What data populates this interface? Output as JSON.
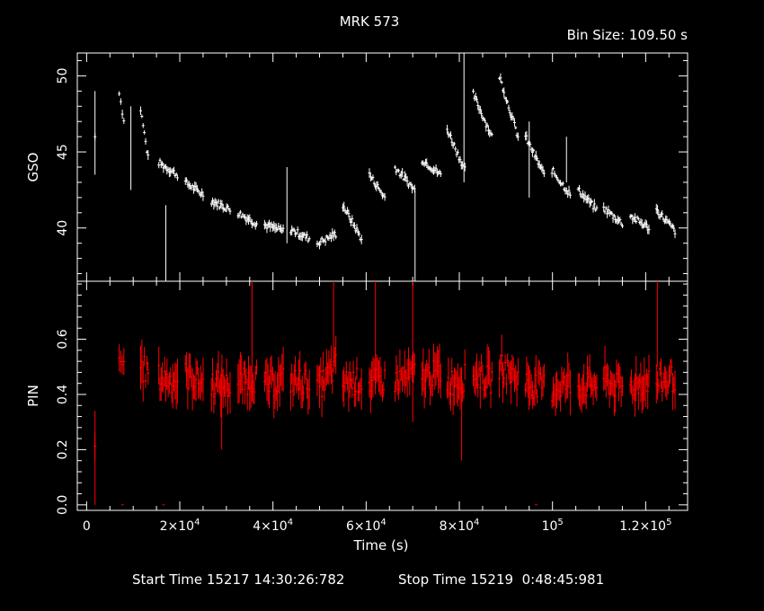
{
  "title": "MRK 573",
  "bin_size_label": "Bin Size: 109.50 s",
  "footer": {
    "start_label": "Start Time 15217 14:30:26:782",
    "stop_label": "Stop Time 15219  0:48:45:981"
  },
  "colors": {
    "background": "#000000",
    "gso": "#ffffff",
    "pin": "#ff0000",
    "axes": "#ffffff"
  },
  "chart_data": {
    "type": "scatter",
    "title": "MRK 573",
    "xlabel": "Time (s)",
    "xlim": [
      -2000,
      129000
    ],
    "x_ticks": [
      {
        "value": 0,
        "base": "0",
        "exp": ""
      },
      {
        "value": 20000,
        "base": "2×10",
        "exp": "4"
      },
      {
        "value": 40000,
        "base": "4×10",
        "exp": "4"
      },
      {
        "value": 60000,
        "base": "6×10",
        "exp": "4"
      },
      {
        "value": 80000,
        "base": "8×10",
        "exp": "4"
      },
      {
        "value": 100000,
        "base": "10",
        "exp": "5"
      },
      {
        "value": 120000,
        "base": "1.2×10",
        "exp": "5"
      }
    ],
    "panels": [
      {
        "name": "GSO",
        "ylabel": "GSO",
        "ylim": [
          36.5,
          51.5
        ],
        "y_ticks": [
          40,
          45,
          50
        ],
        "color": "#ffffff",
        "segments": [
          {
            "t0": 1800,
            "t1": 1800,
            "v0": 46,
            "v1": 46
          },
          {
            "t0": 7000,
            "t1": 8000,
            "v0": 49,
            "v1": 47
          },
          {
            "t0": 11600,
            "t1": 13200,
            "v0": 47.8,
            "v1": 44.6
          },
          {
            "t0": 15500,
            "t1": 19500,
            "v0": 44.3,
            "v1": 43.5
          },
          {
            "t0": 21200,
            "t1": 25000,
            "v0": 43,
            "v1": 42.2
          },
          {
            "t0": 26800,
            "t1": 30800,
            "v0": 41.8,
            "v1": 41.2
          },
          {
            "t0": 32500,
            "t1": 36500,
            "v0": 41,
            "v1": 40.3
          },
          {
            "t0": 38200,
            "t1": 42200,
            "v0": 40.2,
            "v1": 39.8
          },
          {
            "t0": 43800,
            "t1": 47800,
            "v0": 39.9,
            "v1": 39.3
          },
          {
            "t0": 49500,
            "t1": 53500,
            "v0": 39,
            "v1": 39.6
          },
          {
            "t0": 55000,
            "t1": 59000,
            "v0": 41.5,
            "v1": 39.3
          },
          {
            "t0": 60700,
            "t1": 64000,
            "v0": 43.5,
            "v1": 42
          },
          {
            "t0": 66200,
            "t1": 70400,
            "v0": 44,
            "v1": 42.5
          },
          {
            "t0": 72000,
            "t1": 76000,
            "v0": 44.5,
            "v1": 43.5
          },
          {
            "t0": 77400,
            "t1": 81200,
            "v0": 46.5,
            "v1": 43.8
          },
          {
            "t0": 83000,
            "t1": 87000,
            "v0": 48.8,
            "v1": 46
          },
          {
            "t0": 88600,
            "t1": 92600,
            "v0": 50,
            "v1": 46
          },
          {
            "t0": 94200,
            "t1": 98200,
            "v0": 46,
            "v1": 43.5
          },
          {
            "t0": 99900,
            "t1": 103800,
            "v0": 43.8,
            "v1": 42.2
          },
          {
            "t0": 105500,
            "t1": 109500,
            "v0": 42.5,
            "v1": 41.2
          },
          {
            "t0": 111000,
            "t1": 115000,
            "v0": 41.3,
            "v1": 40.3
          },
          {
            "t0": 116700,
            "t1": 120700,
            "v0": 40.8,
            "v1": 40
          },
          {
            "t0": 122300,
            "t1": 126300,
            "v0": 41.2,
            "v1": 39.8
          }
        ],
        "spikes": [
          {
            "t": 1800,
            "lo": 43.5,
            "hi": 49
          },
          {
            "t": 9500,
            "lo": 42.5,
            "hi": 48
          },
          {
            "t": 17000,
            "lo": 36.5,
            "hi": 41.5
          },
          {
            "t": 43000,
            "lo": 39,
            "hi": 44
          },
          {
            "t": 70500,
            "lo": 36.5,
            "hi": 42.5
          },
          {
            "t": 81000,
            "lo": 43,
            "hi": 51.5
          },
          {
            "t": 95000,
            "lo": 42,
            "hi": 47
          },
          {
            "t": 103000,
            "lo": 43,
            "hi": 46
          }
        ]
      },
      {
        "name": "PIN",
        "ylabel": "PIN",
        "ylim": [
          -0.02,
          0.81
        ],
        "y_ticks": [
          0,
          0.2,
          0.4,
          0.6
        ],
        "color": "#ff0000",
        "segments": [
          {
            "t0": 1800,
            "t1": 1800,
            "v0": 0.17,
            "v1": 0.17
          },
          {
            "t0": 7000,
            "t1": 8000,
            "v0": 0.5,
            "v1": 0.52
          },
          {
            "t0": 11600,
            "t1": 13200,
            "v0": 0.5,
            "v1": 0.48
          },
          {
            "t0": 15500,
            "t1": 19500,
            "v0": 0.46,
            "v1": 0.45
          },
          {
            "t0": 21200,
            "t1": 25000,
            "v0": 0.47,
            "v1": 0.44
          },
          {
            "t0": 26800,
            "t1": 30800,
            "v0": 0.44,
            "v1": 0.43
          },
          {
            "t0": 32500,
            "t1": 36500,
            "v0": 0.44,
            "v1": 0.46
          },
          {
            "t0": 38200,
            "t1": 42200,
            "v0": 0.43,
            "v1": 0.45
          },
          {
            "t0": 43800,
            "t1": 47800,
            "v0": 0.45,
            "v1": 0.44
          },
          {
            "t0": 49500,
            "t1": 53500,
            "v0": 0.42,
            "v1": 0.5
          },
          {
            "t0": 55000,
            "t1": 59000,
            "v0": 0.44,
            "v1": 0.45
          },
          {
            "t0": 60700,
            "t1": 64000,
            "v0": 0.44,
            "v1": 0.45
          },
          {
            "t0": 66200,
            "t1": 70400,
            "v0": 0.45,
            "v1": 0.47
          },
          {
            "t0": 72000,
            "t1": 76000,
            "v0": 0.46,
            "v1": 0.48
          },
          {
            "t0": 77400,
            "t1": 81200,
            "v0": 0.44,
            "v1": 0.46
          },
          {
            "t0": 83000,
            "t1": 87000,
            "v0": 0.48,
            "v1": 0.45
          },
          {
            "t0": 88600,
            "t1": 92600,
            "v0": 0.5,
            "v1": 0.46
          },
          {
            "t0": 94200,
            "t1": 98200,
            "v0": 0.44,
            "v1": 0.43
          },
          {
            "t0": 99900,
            "t1": 103800,
            "v0": 0.42,
            "v1": 0.44
          },
          {
            "t0": 105500,
            "t1": 109500,
            "v0": 0.43,
            "v1": 0.44
          },
          {
            "t0": 111000,
            "t1": 115000,
            "v0": 0.45,
            "v1": 0.42
          },
          {
            "t0": 116700,
            "t1": 120700,
            "v0": 0.43,
            "v1": 0.45
          },
          {
            "t0": 122300,
            "t1": 126300,
            "v0": 0.44,
            "v1": 0.46
          }
        ],
        "spikes": [
          {
            "t": 1800,
            "lo": 0,
            "hi": 0.34
          },
          {
            "t": 29000,
            "lo": 0.2,
            "hi": 0.5
          },
          {
            "t": 35500,
            "lo": 0.4,
            "hi": 0.81
          },
          {
            "t": 53000,
            "lo": 0.5,
            "hi": 0.81
          },
          {
            "t": 62000,
            "lo": 0.4,
            "hi": 0.81
          },
          {
            "t": 70000,
            "lo": 0.3,
            "hi": 0.81
          },
          {
            "t": 80500,
            "lo": 0.16,
            "hi": 0.5
          },
          {
            "t": 122500,
            "lo": 0.5,
            "hi": 0.81
          }
        ],
        "baseline_marks": [
          7700,
          16500,
          96500
        ]
      }
    ]
  }
}
